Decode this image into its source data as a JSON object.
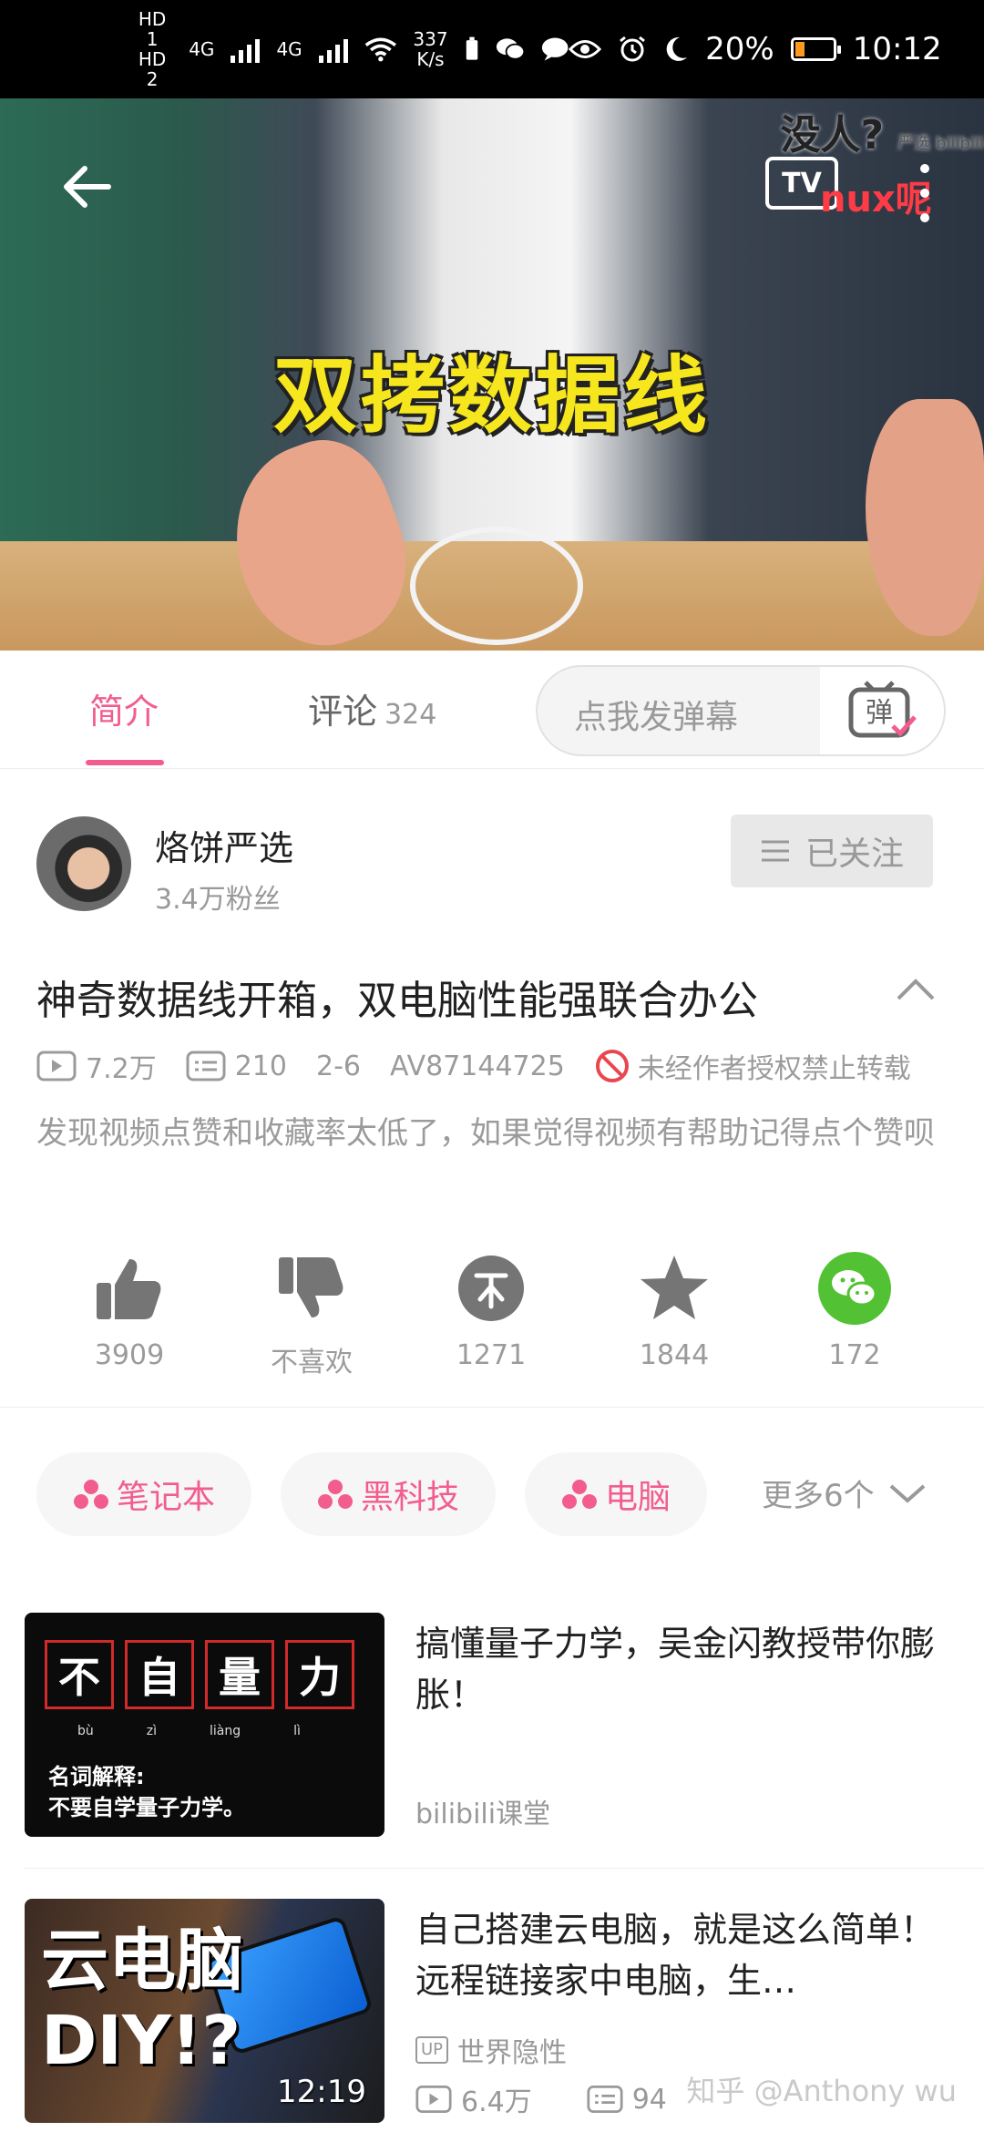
{
  "status_bar": {
    "hd1": "HD 1",
    "hd2": "HD 2",
    "net1": "4G",
    "net2": "4G",
    "speed": "337",
    "speed_unit": "K/s",
    "battery": "20%",
    "time": "10:12"
  },
  "video": {
    "caption": "双拷数据线",
    "watermark": "没人?",
    "watermark_small": "严选 bilibili",
    "overlay_tag": "nux呢",
    "tv_label": "TV"
  },
  "tabs": {
    "intro": "简介",
    "comments": "评论",
    "comments_count": "324",
    "danmaku_placeholder": "点我发弹幕",
    "danmaku_icon_label": "弹"
  },
  "author": {
    "name": "烙饼严选",
    "fans": "3.4万粉丝",
    "follow_label": "已关注"
  },
  "video_info": {
    "title": "神奇数据线开箱，双电脑性能强联合办公",
    "views": "7.2万",
    "danmaku_count": "210",
    "date": "2-6",
    "av_id": "AV87144725",
    "warning": "未经作者授权禁止转载",
    "description": "发现视频点赞和收藏率太低了，如果觉得视频有帮助记得点个赞呗"
  },
  "actions": {
    "like": "3909",
    "dislike": "不喜欢",
    "coin": "1271",
    "favorite": "1844",
    "share": "172"
  },
  "tags": {
    "tag1": "笔记本",
    "tag2": "黑科技",
    "tag3": "电脑",
    "more": "更多6个"
  },
  "related": {
    "item1": {
      "title": "搞懂量子力学，吴金闪教授带你膨胀！",
      "uploader": "bilibili课堂",
      "thumb_chars": [
        "不",
        "自",
        "量",
        "力"
      ],
      "thumb_pinyin": [
        "bù",
        "zì",
        "liàng",
        "lì"
      ],
      "thumb_line1": "名词解释:",
      "thumb_line2": "不要自学量子力学。"
    },
    "item2": {
      "title": "自己搭建云电脑，就是这么简单！远程链接家中电脑，生…",
      "uploader": "世界隐性",
      "up_badge": "UP",
      "views": "6.4万",
      "danmaku": "94",
      "duration": "12:19",
      "thumb_line1": "云电脑",
      "thumb_line2": "DIY!?"
    }
  },
  "footer": {
    "watermark": "知乎 @Anthony wu"
  },
  "colors": {
    "accent": "#f25d8e",
    "status_bg": "#000000",
    "wechat": "#52c234"
  }
}
